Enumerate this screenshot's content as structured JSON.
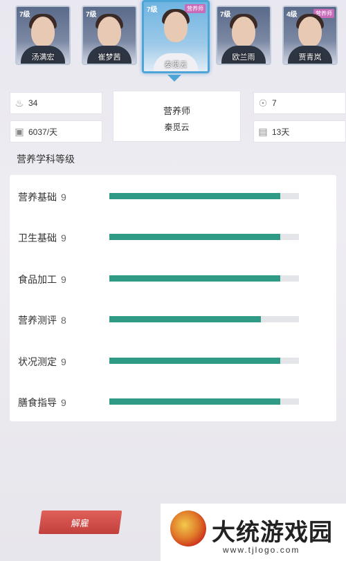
{
  "characters": [
    {
      "level": "7级",
      "tag": "",
      "name": "汤满宏"
    },
    {
      "level": "7级",
      "tag": "",
      "name": "崔梦茜"
    },
    {
      "level": "7级",
      "tag": "营养师",
      "name": "秦觅云"
    },
    {
      "level": "7级",
      "tag": "",
      "name": "欧兰雨"
    },
    {
      "level": "4级",
      "tag": "营养师",
      "name": "贾青岚"
    }
  ],
  "stats": {
    "age": "34",
    "salary": "6037/天",
    "medals": "7",
    "days": "13天"
  },
  "profile": {
    "job": "营养师",
    "name": "秦觅云"
  },
  "section_title": "营养学科等级",
  "skills": [
    {
      "name": "营养基础",
      "value": "9",
      "level": 9
    },
    {
      "name": "卫生基础",
      "value": "9",
      "level": 9
    },
    {
      "name": "食品加工",
      "value": "9",
      "level": 9
    },
    {
      "name": "营养测评",
      "value": "8",
      "level": 8
    },
    {
      "name": "状况测定",
      "value": "9",
      "level": 9
    },
    {
      "name": "膳食指导",
      "value": "9",
      "level": 9
    }
  ],
  "skill_max": 10,
  "fire_button": "解雇",
  "watermark": {
    "text": "大统游戏园",
    "url": "www.tjlogo.com"
  },
  "colors": {
    "bar_fill": "#2f9a86",
    "selected": "#4ea6d8",
    "button": "#c94642"
  }
}
